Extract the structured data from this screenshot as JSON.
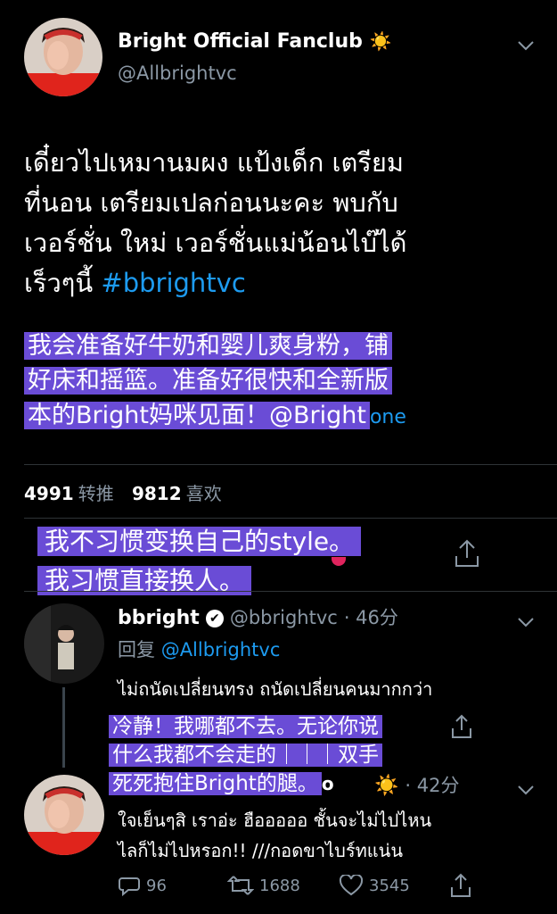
{
  "tweet": {
    "author_name": "Bright Official Fanclub",
    "author_emoji": "☀️",
    "author_handle": "@Allbrightvc",
    "text_lines": [
      "เดี๋ยวไปเหมานมผง แป้งเด็ก เตรียม",
      "ที่นอน เตรียมเปลก่อนนะคะ พบกับ",
      "เวอร์ชั่น ใหม่ เวอร์ชั่นแม่น้อนไบ๊ได้",
      "เร็วๆนี้"
    ],
    "hashtag": "#bbrightvc",
    "translation_lines": [
      "我会准备好牛奶和婴儿爽身粉，铺",
      "好床和摇篮。准备好很快和全新版",
      "本的Bright妈咪见面！@Bright"
    ],
    "translation_tail": "one",
    "retweets_count": "4991",
    "retweets_label": "转推",
    "likes_count": "9812",
    "likes_label": "喜欢"
  },
  "overlay_caption": {
    "line1": "我不习惯变换自己的style。",
    "line2": "我习惯直接换人。"
  },
  "reply1": {
    "author_name": "bbright",
    "verified": "✔",
    "author_handle": "@bbrightvc",
    "time": "· 46分",
    "reply_to_label": "回复",
    "reply_to_handle": "@Allbrightvc",
    "text": "ไม่ถนัดเปลี่ยนทรง ถนัดเปลี่ยนคนมากกว่า",
    "translation_lines": [
      "冷静！我哪都不去。无论你说",
      "什么我都不会走的｜｜｜双手",
      "死死抱住Bright的腿。"
    ],
    "translation_tail": "o"
  },
  "reply2": {
    "author_emoji": "☀️",
    "time": "· 42分",
    "text_lines": [
      "ใจเย็นๆสิ เราอ่ะ ฮือออออ ชั้นจะไม่ไปไหน",
      "ไลก็ไม่ไปหรอก!! ///กอดขาไบร์ทแน่น"
    ],
    "replies_count": "96",
    "retweets_count": "1688",
    "likes_count": "3545"
  },
  "icons": {
    "chevron": "chevron-down-icon",
    "share": "share-icon",
    "reply": "reply-icon",
    "retweet": "retweet-icon",
    "like": "heart-icon"
  },
  "colors": {
    "background": "#000000",
    "link": "#1d9bf0",
    "highlight": "#6a4cd6",
    "muted": "#8b98a5"
  }
}
